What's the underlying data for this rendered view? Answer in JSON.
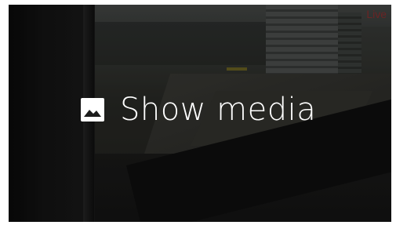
{
  "status": {
    "live_label": "Live",
    "live_color": "#6a2424"
  },
  "card": {
    "label": "Show media",
    "icon": "image-icon"
  }
}
